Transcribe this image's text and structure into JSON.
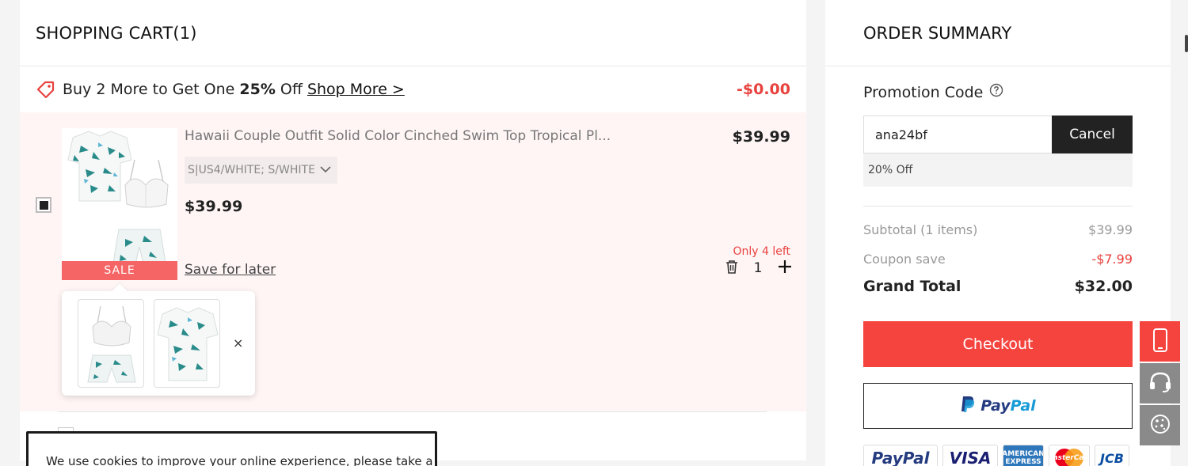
{
  "cart": {
    "title": "SHOPPING CART(1)",
    "promo": {
      "prefix": "Buy 2 More to Get One ",
      "bold": "25%",
      "suffix": " Off",
      "link": "Shop More >",
      "discount": "-$0.00"
    },
    "item": {
      "name": "Hawaii Couple Outfit Solid Color Cinched Swim Top Tropical Pl...",
      "variant": "S|US4/WHITE; S/WHITE",
      "price": "$39.99",
      "price_right": "$39.99",
      "badge": "SALE",
      "save_later": "Save for later",
      "stock": "Only 4 left",
      "quantity": "1",
      "popup_close": "×"
    },
    "cookie_text": "We use cookies to improve your online experience, please take a"
  },
  "summary": {
    "title": "ORDER SUMMARY",
    "promo_label": "Promotion Code",
    "promo_value": "ana24bf",
    "cancel_label": "Cancel",
    "applied": "20% Off",
    "subtotal_label": "Subtotal (1 items)",
    "subtotal_value": "$39.99",
    "coupon_label": "Coupon save",
    "coupon_value": "-$7.99",
    "total_label": "Grand Total",
    "total_value": "$32.00",
    "checkout_label": "Checkout",
    "paypal_a": "Pay",
    "paypal_b": "Pal",
    "payment_logos": [
      "PayPal",
      "VISA",
      "AMERICAN EXPRESS",
      "MasterCard",
      "JCB"
    ]
  },
  "colors": {
    "accent": "#f5433e",
    "sale_badge": "#f56565",
    "item_bg": "#fff5f5",
    "dark": "#222222"
  },
  "side_tools": [
    "mobile-icon",
    "headset-icon",
    "cookie-icon"
  ]
}
